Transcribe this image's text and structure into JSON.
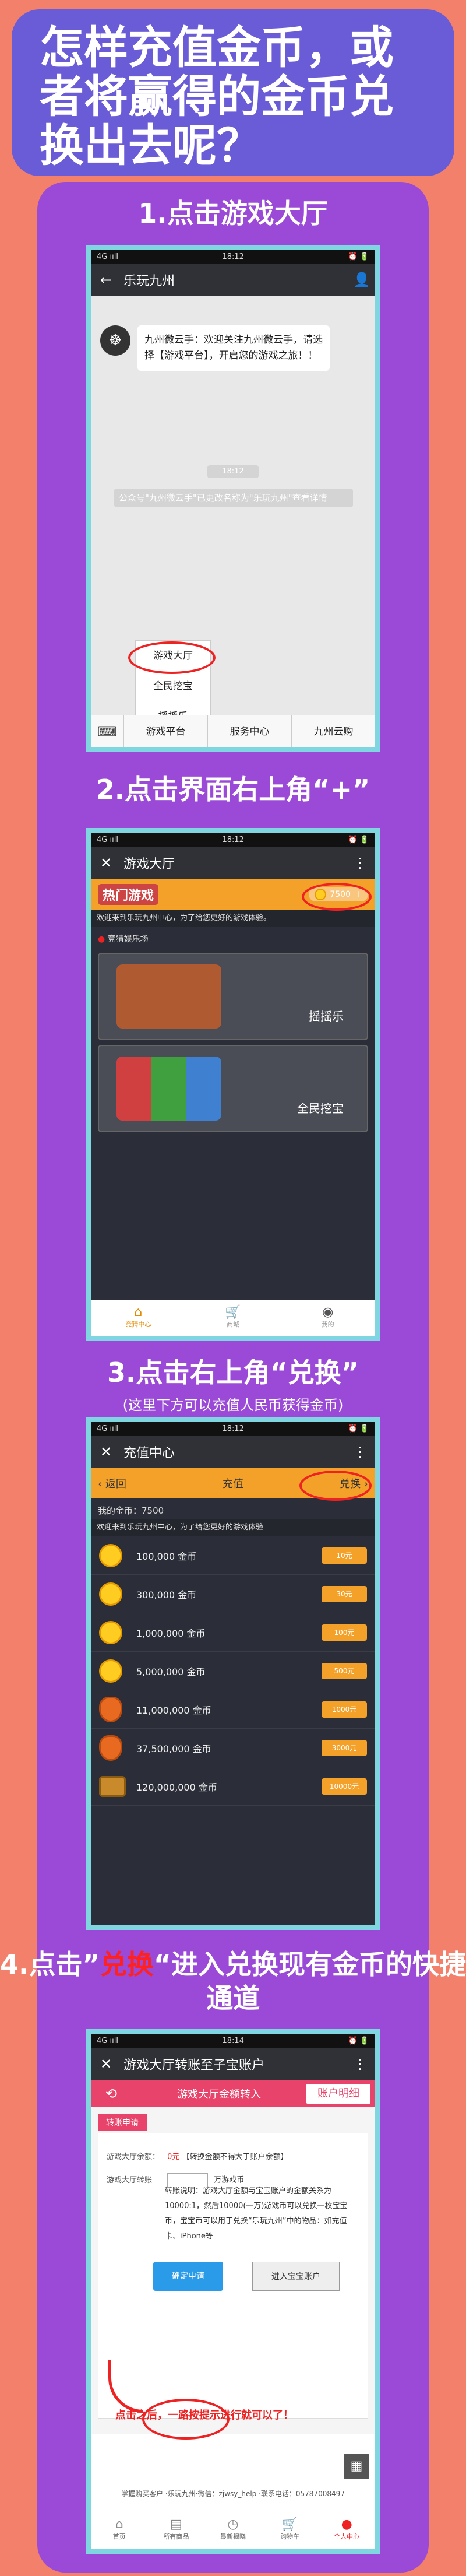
{
  "header": {
    "title": "怎样充值金币，或者将赢得的金币兑换出去呢？"
  },
  "steps": {
    "s1": "1.点击游戏大厅",
    "s2": "2.点击界面右上角“+”",
    "s3": "3.点击右上角“兑换”",
    "s3_note": "(这里下方可以充值人民币获得金币)",
    "s4_pre": "4.点击”",
    "s4_hl": "兑换",
    "s4_post": "“进入兑换现有金币的快捷通道"
  },
  "phone1": {
    "status_left": "4G ııll",
    "status_time": "18:12",
    "status_right": "⏰ 🔋",
    "title": "乐玩九州",
    "avatar_glyph": "☸",
    "bubble": "九州微云手：欢迎关注九州微云手，请选择【游戏平台】，开启您的游戏之旅！！",
    "time_pill": "18:12",
    "notice": "公众号\"九州微云手\"已更改名称为\"乐玩九州\"查看详情",
    "popup": [
      "游戏大厅",
      "全民挖宝",
      "摇摇乐"
    ],
    "menus": [
      "游戏平台",
      "服务中心",
      "九州云购"
    ]
  },
  "phone2": {
    "status_left": "4G ııll",
    "status_time": "18:12",
    "title": "游戏大厅",
    "logo": "热门游戏",
    "coins": "7500",
    "marquee": "欢迎来到乐玩九州中心，为了给您更好的游戏体验。",
    "recommend": "竞猜娱乐场",
    "games": [
      "摇摇乐",
      "全民挖宝"
    ],
    "tabs": [
      "竞猜中心",
      "商城",
      "我的"
    ]
  },
  "phone3": {
    "status_left": "4G ııll",
    "status_time": "18:12",
    "title": "充值中心",
    "back": "返回",
    "mid": "充值",
    "exchange": "兑换",
    "balance": "我的金币：7500",
    "marquee": "欢迎来到乐玩九州中心，为了给您更好的游戏体验",
    "packages": [
      {
        "amount": "100,000 金币",
        "btn": "10元"
      },
      {
        "amount": "300,000 金币",
        "btn": "30元"
      },
      {
        "amount": "1,000,000 金币",
        "btn": "100元"
      },
      {
        "amount": "5,000,000 金币",
        "btn": "500元"
      },
      {
        "amount": "11,000,000 金币",
        "btn": "1000元"
      },
      {
        "amount": "37,500,000 金币",
        "btn": "3000元"
      },
      {
        "amount": "120,000,000 金币",
        "btn": "10000元"
      }
    ]
  },
  "phone4": {
    "status_left": "4G ııll",
    "status_time": "18:14",
    "title": "游戏大厅转账至子宝账户",
    "back": "⟲",
    "mid": "游戏大厅金额转入",
    "right": "账户明细",
    "redtab": "转账申请",
    "bal_label": "游戏大厅余额：",
    "bal_value": "0元",
    "bal_note": "【转换金额不得大于账户余额】",
    "input_label": "游戏大厅转账",
    "input_suffix": "万游戏币",
    "desc": "转账说明：游戏大厅金额与宝宝账户的金额关系为10000:1，然后10000(一万)游戏币可以兑换一枚宝宝币，宝宝币可以用于兑换“乐玩九州”中的物品：如充值卡、iPhone等",
    "btn_primary": "确定申请",
    "btn_secondary": "进入宝宝账户",
    "hint": "点击之后，一路按提示进行就可以了！",
    "footnote": "掌握购买客户 ·乐玩九州·微信：zjwsy_help ·联系电话：05787008497",
    "tabs": [
      "首页",
      "所有商品",
      "最新揭晓",
      "购物车",
      "个人中心"
    ]
  }
}
